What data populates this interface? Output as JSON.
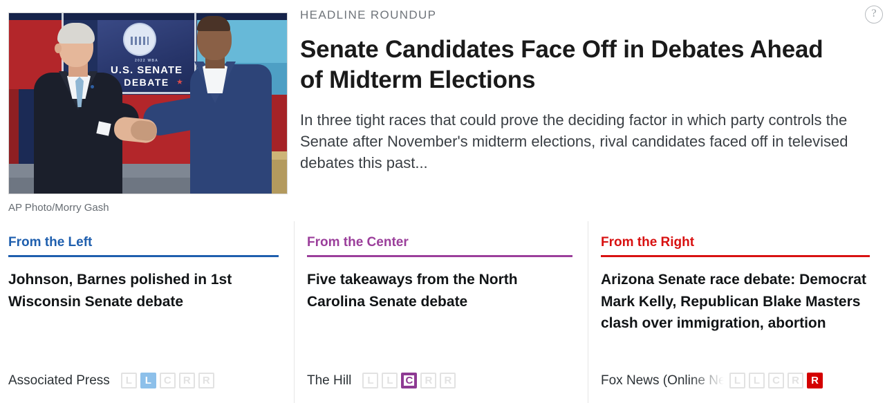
{
  "kicker": "HEADLINE ROUNDUP",
  "headline": "Senate Candidates Face Off in Debates Ahead of Midterm Elections",
  "summary": "In three tight races that could prove the deciding factor in which party controls the Senate after November's midterm elections, rival candidates faced off in televised debates this past...",
  "help_icon": "?",
  "photo": {
    "credit": "AP Photo/Morry Gash",
    "backdrop_sub": "2022 WBA",
    "backdrop_line1": "U.S. SENATE",
    "backdrop_line2": "DEBATE",
    "star": "★"
  },
  "colors": {
    "left": "#1f5fae",
    "center": "#9b3f9b",
    "right": "#d81111",
    "bias_left": "#8dc0ea",
    "bias_center": "#8e3a93",
    "bias_right": "#d40000",
    "kicker": "#6f747a"
  },
  "columns": [
    {
      "label": "From the Left",
      "title": "Johnson, Barnes polished in 1st Wisconsin Senate debate",
      "source": "Associated Press",
      "bias_boxes": [
        "L",
        "L",
        "C",
        "R",
        "R"
      ],
      "bias_active_index": 1,
      "bias_rating": "Lean Left"
    },
    {
      "label": "From the Center",
      "title": "Five takeaways from the North Carolina Senate debate",
      "source": "The Hill",
      "bias_boxes": [
        "L",
        "L",
        "C",
        "R",
        "R"
      ],
      "bias_active_index": 2,
      "bias_rating": "Center"
    },
    {
      "label": "From the Right",
      "title": "Arizona Senate race debate: Democrat Mark Kelly, Republican Blake Masters clash over immigration, abortion",
      "source": "Fox News (Online News)",
      "bias_boxes": [
        "L",
        "L",
        "C",
        "R",
        "R"
      ],
      "bias_active_index": 4,
      "bias_rating": "Right"
    }
  ]
}
